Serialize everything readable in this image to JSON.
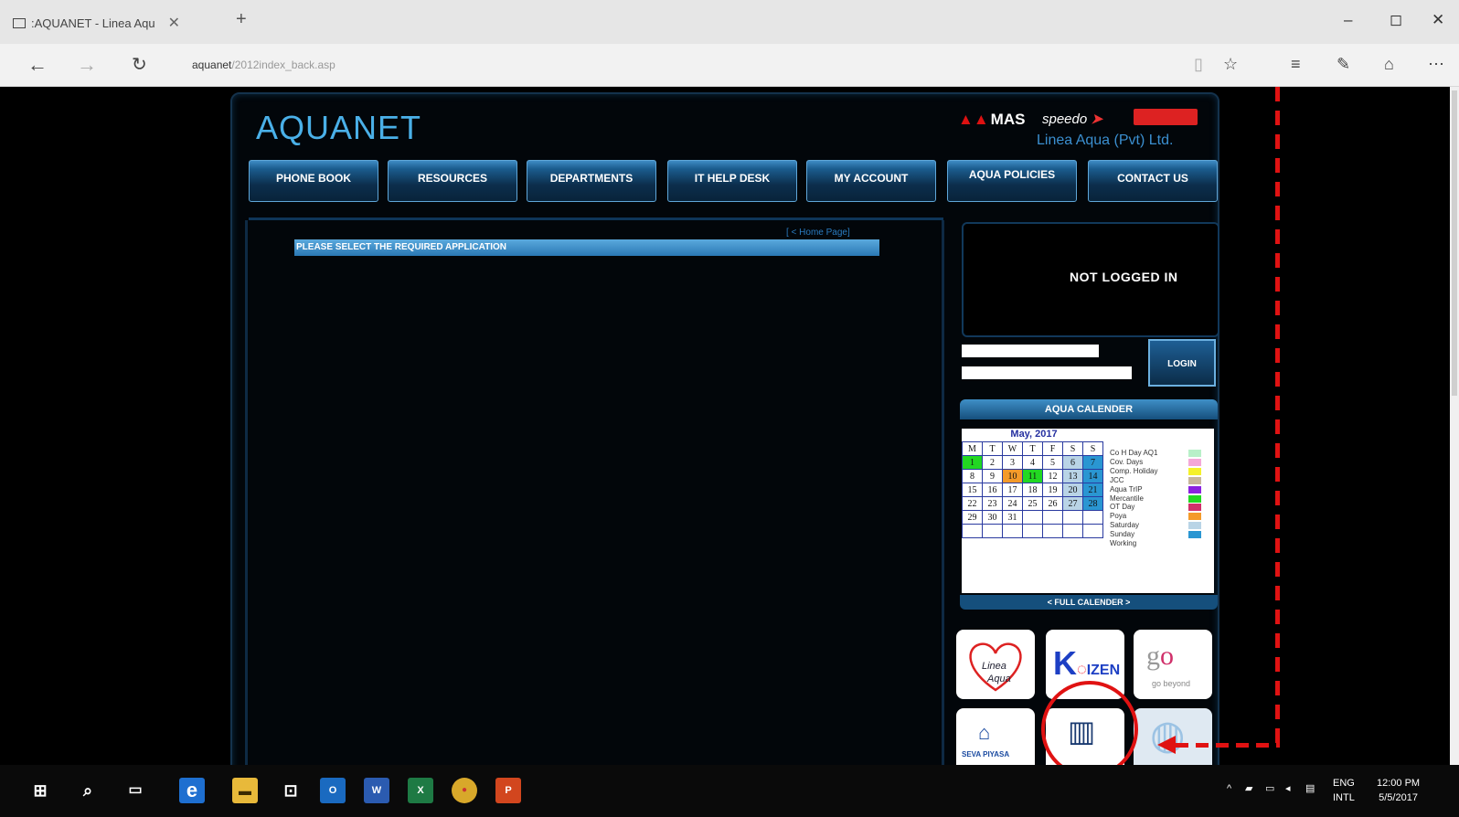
{
  "browser": {
    "tab_title": ":AQUANET - Linea Aqu",
    "url_host": "aquanet",
    "url_path": "/2012index_back.asp",
    "window_controls": [
      "–",
      "◻",
      "✕"
    ]
  },
  "header": {
    "logo": "AQUANET",
    "brand_mas": "MAS",
    "brand_speedo": "speedo",
    "company": "Linea Aqua (Pvt) Ltd."
  },
  "nav": {
    "items": [
      "PHONE BOOK",
      "RESOURCES",
      "DEPARTMENTS",
      "IT HELP DESK",
      "MY ACCOUNT",
      "AQUA POLICIES",
      "CONTACT US"
    ]
  },
  "main": {
    "home_link": "[ < Home Page]",
    "select_banner": "PLEASE SELECT THE REQUIRED APPLICATION"
  },
  "login": {
    "status": "NOT LOGGED IN",
    "button": "LOGIN"
  },
  "calendar": {
    "header": "AQUA CALENDER",
    "month": "May, 2017",
    "day_headers": [
      "M",
      "T",
      "W",
      "T",
      "F",
      "S",
      "S"
    ],
    "weeks": [
      [
        "1",
        "2",
        "3",
        "4",
        "5",
        "6",
        "7"
      ],
      [
        "8",
        "9",
        "10",
        "11",
        "12",
        "13",
        "14"
      ],
      [
        "15",
        "16",
        "17",
        "18",
        "19",
        "20",
        "21"
      ],
      [
        "22",
        "23",
        "24",
        "25",
        "26",
        "27",
        "28"
      ],
      [
        "29",
        "30",
        "31",
        "",
        "",
        "",
        ""
      ],
      [
        "",
        "",
        "",
        "",
        "",
        "",
        ""
      ]
    ],
    "legend": [
      {
        "label": "Co H Day AQ1",
        "color": "#b8f0c8"
      },
      {
        "label": "Cov. Days",
        "color": "#f4a8d8"
      },
      {
        "label": "Comp. Holiday",
        "color": "#f5f22a"
      },
      {
        "label": "JCC",
        "color": "#c7b79a"
      },
      {
        "label": "Aqua TrIP",
        "color": "#8a22e0"
      },
      {
        "label": "Mercantile",
        "color": "#22d822"
      },
      {
        "label": "OT Day",
        "color": "#d0306a"
      },
      {
        "label": "Poya",
        "color": "#f49a2a"
      },
      {
        "label": "Saturday",
        "color": "#b9d4e6"
      },
      {
        "label": "Sunday",
        "color": "#2a96d2"
      },
      {
        "label": "Working",
        "color": "#ffffff"
      }
    ],
    "footer": "< FULL CALENDER >"
  },
  "apps": {
    "linea_aqua_line1": "Linea",
    "linea_aqua_line2": "Aqua",
    "kaizen_k": "K",
    "kaizen_rest": "IZEN",
    "go_beyond": "go beyond",
    "seva_piyasa": "SEVA PIYASA"
  },
  "taskbar": {
    "lang_top": "ENG",
    "lang_bottom": "INTL",
    "time": "12:00 PM",
    "date": "5/5/2017"
  }
}
